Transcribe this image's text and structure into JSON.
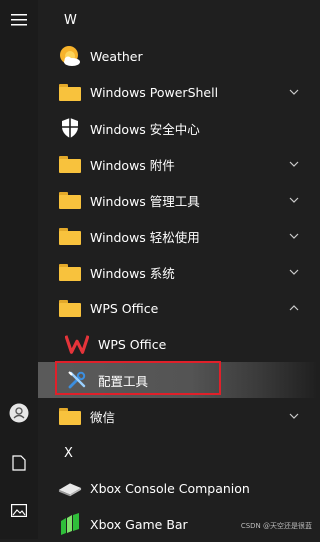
{
  "rail": {
    "menu_icon": "hamburger-menu-icon",
    "user_icon": "user-icon",
    "documents_icon": "document-icon",
    "pictures_icon": "pictures-icon"
  },
  "sections": [
    {
      "letter": "W"
    },
    {
      "letter": "X"
    }
  ],
  "apps": [
    {
      "label": "Weather",
      "icon": "weather-icon",
      "expandable": false
    },
    {
      "label": "Windows PowerShell",
      "icon": "folder-icon",
      "expandable": true
    },
    {
      "label": "Windows 安全中心",
      "icon": "shield-icon",
      "expandable": false
    },
    {
      "label": "Windows 附件",
      "icon": "folder-icon",
      "expandable": true
    },
    {
      "label": "Windows 管理工具",
      "icon": "folder-icon",
      "expandable": true
    },
    {
      "label": "Windows 轻松使用",
      "icon": "folder-icon",
      "expandable": true
    },
    {
      "label": "Windows 系统",
      "icon": "folder-icon",
      "expandable": true
    },
    {
      "label": "WPS Office",
      "icon": "folder-icon",
      "expandable": true,
      "expanded": true
    },
    {
      "label": "WPS Office",
      "icon": "wps-logo-icon",
      "sub": true
    },
    {
      "label": "配置工具",
      "icon": "tools-icon",
      "sub": true,
      "selected": true
    },
    {
      "label": "微信",
      "icon": "folder-icon",
      "expandable": true
    },
    {
      "label": "Xbox Console Companion",
      "icon": "xbox-console-icon",
      "expandable": false
    },
    {
      "label": "Xbox Game Bar",
      "icon": "xbox-game-bar-icon",
      "expandable": false
    }
  ],
  "watermark": "CSDN @天空还是很蓝",
  "colors": {
    "background": "#1f1f1f",
    "folder": "#f8c23d",
    "highlight_border": "#e0202a",
    "wps_red": "#e5343a",
    "selected_bg": "#5a5a5a"
  }
}
